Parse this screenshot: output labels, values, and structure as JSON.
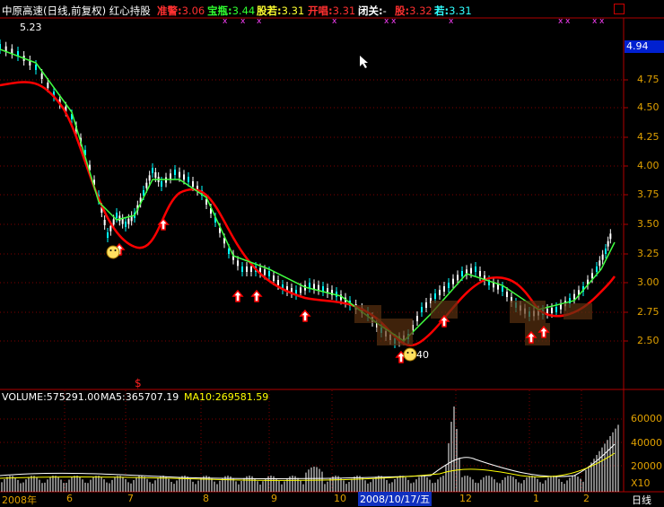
{
  "header": {
    "title": "中原高速(日线,前复权) 红心持股",
    "indicators": [
      {
        "label": "准警:",
        "value": "3.06",
        "color": "#ff3030"
      },
      {
        "label": "宝瓶:",
        "value": "3.44",
        "color": "#30ff30"
      },
      {
        "label": "股若:",
        "value": "3.31",
        "color": "#ffff30"
      },
      {
        "label": "开唱:",
        "value": "3.31",
        "color": "#ff3030"
      },
      {
        "label": "闭关:",
        "value": "-",
        "color": "#ffffff"
      },
      {
        "label": "股:",
        "value": "3.32",
        "color": "#ff3030"
      },
      {
        "label": "若:",
        "value": "3.31",
        "color": "#30ffff"
      }
    ]
  },
  "price_axis": {
    "ticks": [
      "4.75",
      "4.50",
      "4.25",
      "4.00",
      "3.75",
      "3.50",
      "3.25",
      "3.00",
      "2.75",
      "2.50"
    ],
    "last_price": "4.94"
  },
  "annotations": {
    "high_label": "5.23",
    "low_label": "40",
    "signal_mark": "$"
  },
  "volume": {
    "volume_label": "VOLUME:575291.00",
    "ma5_label": "MA5:365707.19",
    "ma10_label": "MA10:269581.59",
    "ticks": [
      "60000",
      "40000",
      "20000"
    ],
    "unit": "X10"
  },
  "dates": {
    "ticks": [
      "2008年",
      "6",
      "7",
      "8",
      "9",
      "10",
      "12",
      "1",
      "2"
    ],
    "selected": "2008/10/17/五",
    "period_button": "日线"
  },
  "colors": {
    "ma_line": "#ff0000",
    "price_up": "#ffffff",
    "price_down": "#00ffff",
    "volume_ma10": "#ffff00"
  }
}
